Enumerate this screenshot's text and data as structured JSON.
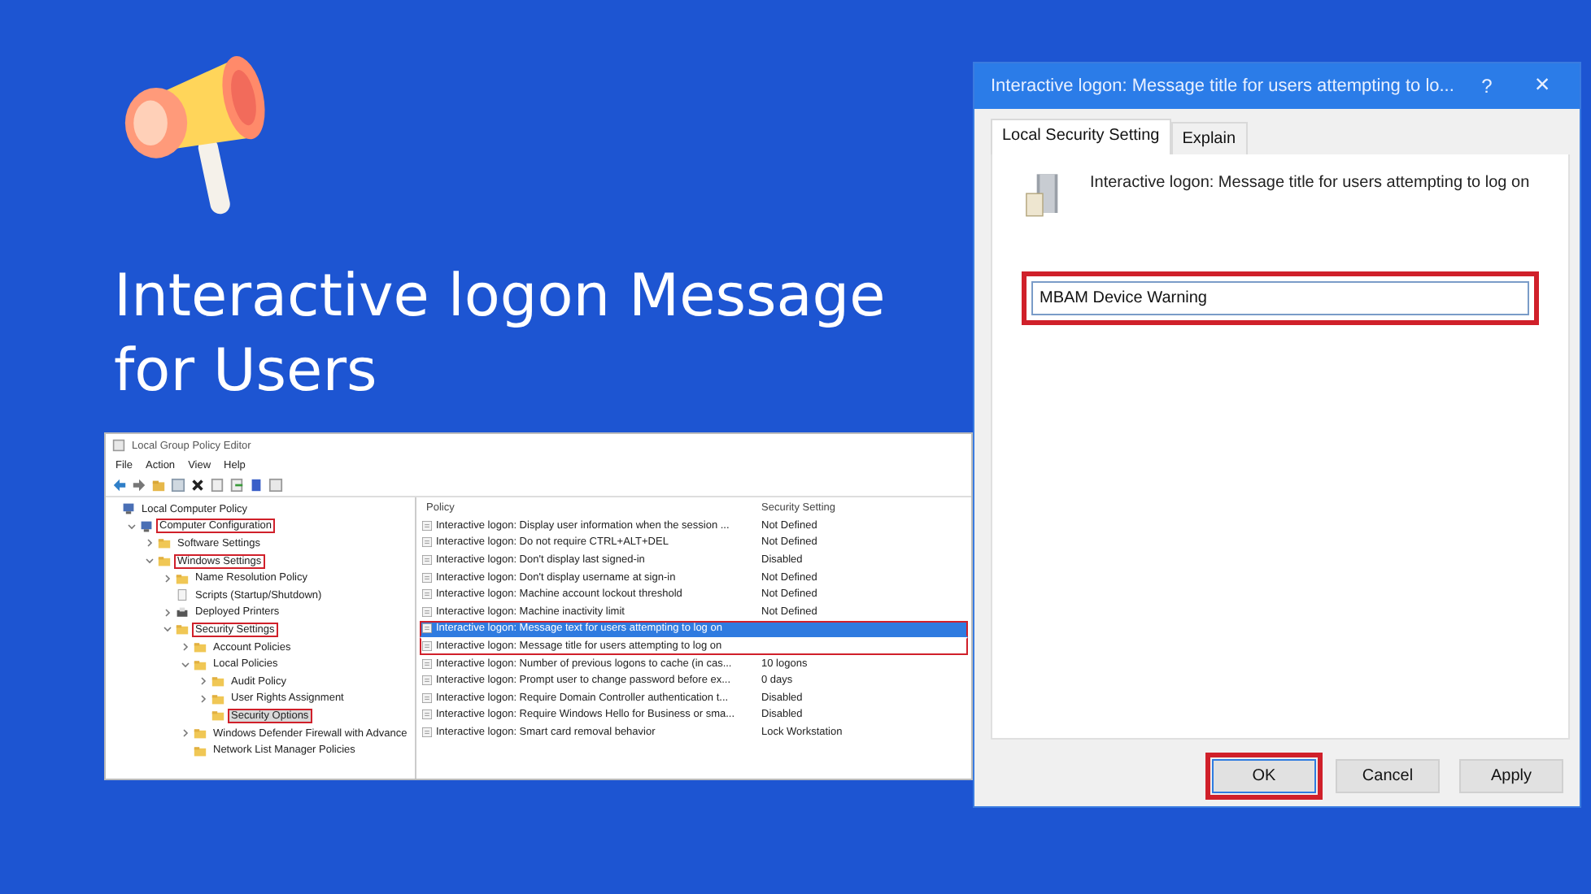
{
  "headline": "Interactive logon Message for Users",
  "editor": {
    "title": "Local Group Policy Editor",
    "menu": [
      "File",
      "Action",
      "View",
      "Help"
    ],
    "tree": [
      {
        "label": "Local Computer Policy",
        "kind": "computer",
        "selected": false,
        "highlighted": false,
        "children": [
          {
            "label": "Computer Configuration",
            "kind": "computer",
            "expanded": true,
            "selected": false,
            "highlighted": true,
            "children": [
              {
                "label": "Software Settings",
                "kind": "folder",
                "expanded": false,
                "selected": false,
                "highlighted": false
              },
              {
                "label": "Windows Settings",
                "kind": "folder",
                "expanded": true,
                "selected": false,
                "highlighted": true,
                "children": [
                  {
                    "label": "Name Resolution Policy",
                    "kind": "folder",
                    "expanded": false,
                    "selected": false,
                    "highlighted": false
                  },
                  {
                    "label": "Scripts (Startup/Shutdown)",
                    "kind": "page",
                    "selected": false,
                    "highlighted": false
                  },
                  {
                    "label": "Deployed Printers",
                    "kind": "printer",
                    "expanded": false,
                    "selected": false,
                    "highlighted": false
                  },
                  {
                    "label": "Security Settings",
                    "kind": "folder",
                    "expanded": true,
                    "selected": false,
                    "highlighted": true,
                    "children": [
                      {
                        "label": "Account Policies",
                        "kind": "folder",
                        "expanded": false,
                        "selected": false,
                        "highlighted": false
                      },
                      {
                        "label": "Local Policies",
                        "kind": "folder",
                        "expanded": true,
                        "selected": false,
                        "highlighted": false,
                        "children": [
                          {
                            "label": "Audit Policy",
                            "kind": "folder",
                            "expanded": false,
                            "selected": false,
                            "highlighted": false
                          },
                          {
                            "label": "User Rights Assignment",
                            "kind": "folder",
                            "expanded": false,
                            "selected": false,
                            "highlighted": false
                          },
                          {
                            "label": "Security Options",
                            "kind": "folder",
                            "selected": true,
                            "highlighted": true
                          }
                        ]
                      },
                      {
                        "label": "Windows Defender Firewall with Advance",
                        "kind": "folder",
                        "expanded": false,
                        "selected": false,
                        "highlighted": false
                      },
                      {
                        "label": "Network List Manager Policies",
                        "kind": "folder",
                        "selected": false,
                        "highlighted": false
                      }
                    ]
                  }
                ]
              }
            ]
          }
        ]
      }
    ],
    "columns": [
      "Policy",
      "Security Setting"
    ],
    "rows": [
      {
        "policy": "Interactive logon: Display user information when the session ...",
        "setting": "Not Defined",
        "selected": false,
        "highlighted": false
      },
      {
        "policy": "Interactive logon: Do not require CTRL+ALT+DEL",
        "setting": "Not Defined",
        "selected": false,
        "highlighted": false
      },
      {
        "policy": "Interactive logon: Don't display last signed-in",
        "setting": "Disabled",
        "selected": false,
        "highlighted": false
      },
      {
        "policy": "Interactive logon: Don't display username at sign-in",
        "setting": "Not Defined",
        "selected": false,
        "highlighted": false
      },
      {
        "policy": "Interactive logon: Machine account lockout threshold",
        "setting": "Not Defined",
        "selected": false,
        "highlighted": false
      },
      {
        "policy": "Interactive logon: Machine inactivity limit",
        "setting": "Not Defined",
        "selected": false,
        "highlighted": false
      },
      {
        "policy": "Interactive logon: Message text for users attempting to log on",
        "selected": true,
        "highlighted": true
      },
      {
        "policy": "Interactive logon: Message title for users attempting to log on",
        "selected": false,
        "highlighted": true
      },
      {
        "policy": "Interactive logon: Number of previous logons to cache (in cas...",
        "setting": "10 logons",
        "selected": false,
        "highlighted": false
      },
      {
        "policy": "Interactive logon: Prompt user to change password before ex...",
        "setting": "0 days",
        "selected": false,
        "highlighted": false
      },
      {
        "policy": "Interactive logon: Require Domain Controller authentication t...",
        "setting": "Disabled",
        "selected": false,
        "highlighted": false
      },
      {
        "policy": "Interactive logon: Require Windows Hello for Business or sma...",
        "setting": "Disabled",
        "selected": false,
        "highlighted": false
      },
      {
        "policy": "Interactive logon: Smart card removal behavior",
        "setting": "Lock Workstation",
        "selected": false,
        "highlighted": false
      }
    ]
  },
  "dialog": {
    "title": "Interactive logon: Message title for users attempting to lo...",
    "help": "?",
    "close": "×",
    "tabs": [
      {
        "label": "Local Security Setting",
        "selected": true
      },
      {
        "label": "Explain",
        "selected": false
      }
    ],
    "description": "Interactive logon: Message title for users attempting to log on",
    "value": "MBAM Device Warning",
    "buttons": [
      {
        "label": "OK",
        "highlighted": true,
        "default": true
      },
      {
        "label": "Cancel",
        "highlighted": false,
        "default": false
      },
      {
        "label": "Apply",
        "highlighted": false,
        "default": false
      }
    ]
  }
}
